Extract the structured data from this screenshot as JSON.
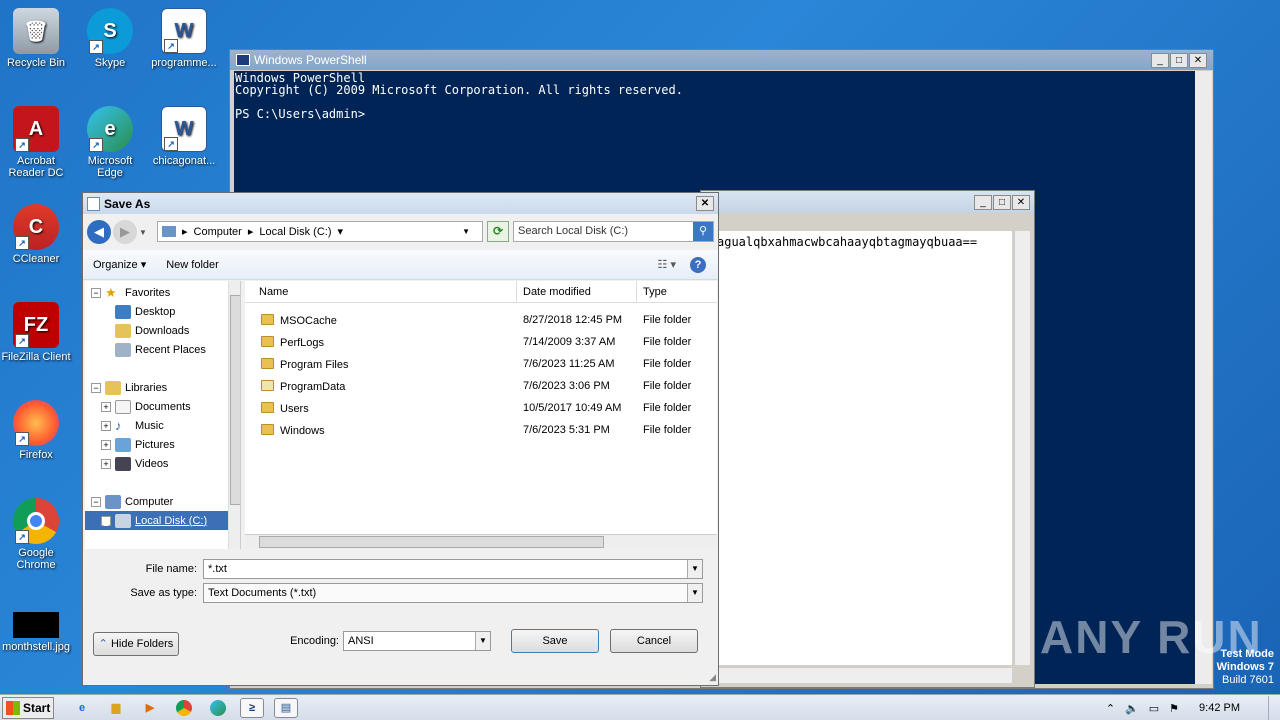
{
  "desktop": {
    "icons": [
      {
        "label": "Recycle Bin"
      },
      {
        "label": "Skype"
      },
      {
        "label": "programme..."
      },
      {
        "label": "Acrobat Reader DC"
      },
      {
        "label": "Microsoft Edge"
      },
      {
        "label": "chicagonat..."
      },
      {
        "label": "CCleaner"
      },
      {
        "label": "FileZilla Client"
      },
      {
        "label": "Firefox"
      },
      {
        "label": "Google Chrome"
      },
      {
        "label": "monthstell.jpg"
      }
    ],
    "watermark": "ANY RUN",
    "test_mode": {
      "line1": "Test Mode",
      "line2": "Windows 7",
      "line3": "Build 7601"
    }
  },
  "powershell": {
    "title": "Windows PowerShell",
    "lines": [
      "Windows PowerShell",
      "Copyright (C) 2009 Microsoft Corporation. All rights reserved.",
      "",
      "PS C:\\Users\\admin>"
    ]
  },
  "notepad": {
    "text": "agualqbxahmacwbcahaayqbtagmayqbuaa=="
  },
  "dialog": {
    "title": "Save As",
    "breadcrumb": [
      "Computer",
      "Local Disk (C:)"
    ],
    "search_placeholder": "Search Local Disk (C:)",
    "toolbar": {
      "organize": "Organize",
      "new_folder": "New folder"
    },
    "nav": {
      "favorites": "Favorites",
      "fav_items": [
        "Desktop",
        "Downloads",
        "Recent Places"
      ],
      "libraries": "Libraries",
      "lib_items": [
        "Documents",
        "Music",
        "Pictures",
        "Videos"
      ],
      "computer": "Computer",
      "selected": "Local Disk (C:)"
    },
    "columns": {
      "name": "Name",
      "date": "Date modified",
      "type": "Type"
    },
    "files": [
      {
        "name": "MSOCache",
        "date": "8/27/2018 12:45 PM",
        "type": "File folder"
      },
      {
        "name": "PerfLogs",
        "date": "7/14/2009 3:37 AM",
        "type": "File folder"
      },
      {
        "name": "Program Files",
        "date": "7/6/2023 11:25 AM",
        "type": "File folder"
      },
      {
        "name": "ProgramData",
        "date": "7/6/2023 3:06 PM",
        "type": "File folder"
      },
      {
        "name": "Users",
        "date": "10/5/2017 10:49 AM",
        "type": "File folder"
      },
      {
        "name": "Windows",
        "date": "7/6/2023 5:31 PM",
        "type": "File folder"
      }
    ],
    "file_name_label": "File name:",
    "file_name_value": "*.txt",
    "save_type_label": "Save as type:",
    "save_type_value": "Text Documents (*.txt)",
    "hide_folders": "Hide Folders",
    "encoding_label": "Encoding:",
    "encoding_value": "ANSI",
    "save": "Save",
    "cancel": "Cancel"
  },
  "taskbar": {
    "start": "Start",
    "time": "9:42 PM"
  }
}
